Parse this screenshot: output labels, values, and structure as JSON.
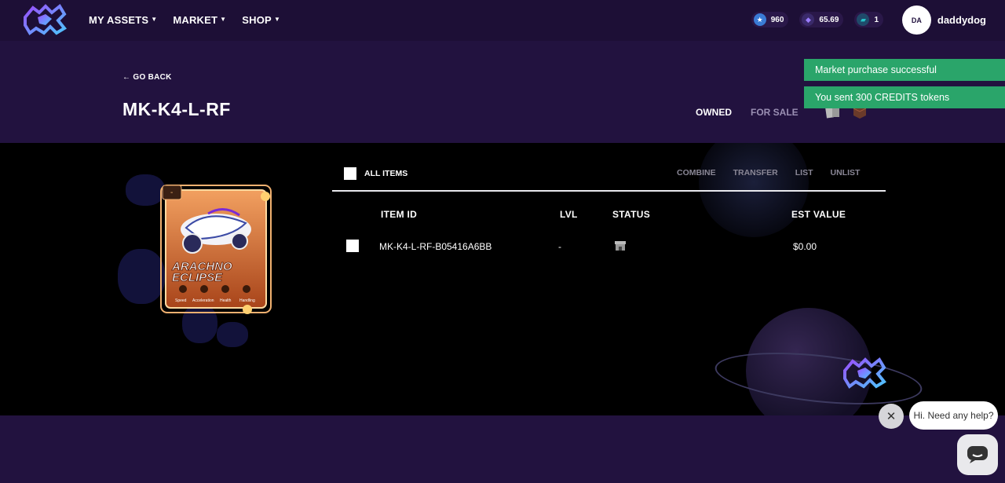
{
  "nav": {
    "menu": [
      {
        "label": "MY ASSETS",
        "name": "menu-my-assets"
      },
      {
        "label": "MARKET",
        "name": "menu-market"
      },
      {
        "label": "SHOP",
        "name": "menu-shop"
      }
    ],
    "stats": [
      {
        "value": "960",
        "icon": "star-coin-icon",
        "color": "#3a7bd5"
      },
      {
        "value": "65.69",
        "icon": "gem-icon",
        "color": "#7a5cf0"
      },
      {
        "value": "1",
        "icon": "ticket-icon",
        "color": "#27c2c7"
      }
    ],
    "user": {
      "initials": "DA",
      "name": "daddydog"
    }
  },
  "header": {
    "go_back": "← GO BACK",
    "title": "MK-K4-L-RF",
    "tab_owned": "OWNED",
    "tab_for_sale": "FOR SALE"
  },
  "toasts": [
    "Market purchase successful",
    "You sent 300 CREDITS tokens"
  ],
  "card": {
    "name_line1": "ARACHNO",
    "name_line2": "ECLIPSE",
    "stat_labels": [
      "Speed",
      "Acceleration",
      "Health",
      "Handling"
    ]
  },
  "toolbar": {
    "all_items": "ALL ITEMS",
    "combine": "COMBINE",
    "transfer": "TRANSFER",
    "list": "LIST",
    "unlist": "UNLIST"
  },
  "table": {
    "headers": {
      "item_id": "ITEM ID",
      "lvl": "LVL",
      "status": "STATUS",
      "est_value": "EST VALUE"
    },
    "rows": [
      {
        "item_id": "MK-K4-L-RF-B05416A6BB",
        "lvl": "-",
        "status_icon": "storefront-icon",
        "est_value": "$0.00"
      }
    ]
  },
  "chat": {
    "prompt": "Hi. Need any help?"
  },
  "colors": {
    "bg_purple": "#22123f",
    "toast_green": "#2aa56a",
    "card_orange": "#e07a2a"
  }
}
